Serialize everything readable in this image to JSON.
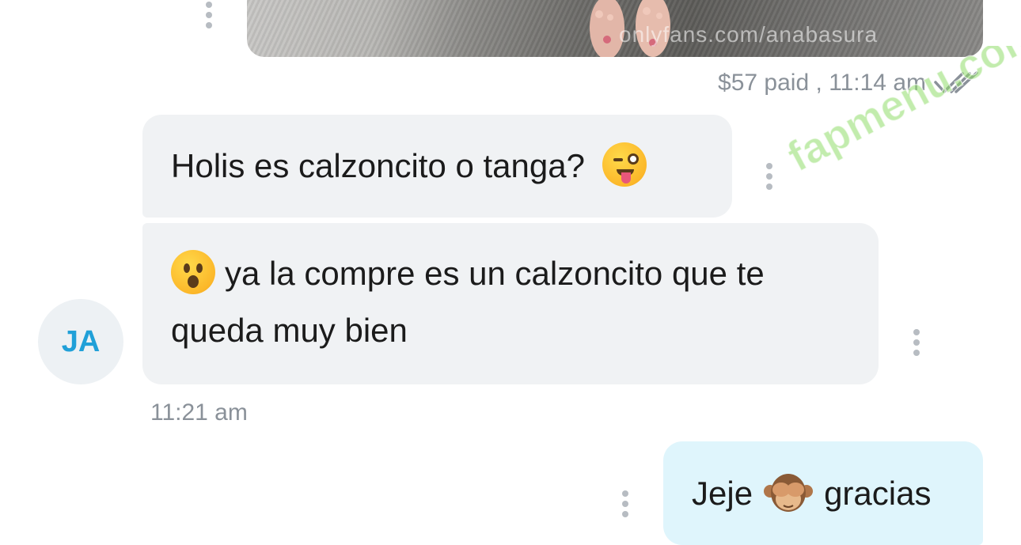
{
  "media": {
    "watermark_text": "onlyfans.com/anabasura",
    "paid_label": "$57 paid , 11:14 am"
  },
  "messages": [
    {
      "id": "m1",
      "direction": "incoming",
      "text": "Holis es calzoncito o tanga?",
      "emoji": "winking-face-with-tongue"
    },
    {
      "id": "m2",
      "direction": "incoming",
      "text_line1": "ya la compre es un calzoncito que te",
      "text_line2": "queda muy bien",
      "emoji": "face-with-open-mouth"
    },
    {
      "id": "m3",
      "direction": "outgoing",
      "text_before": "Jeje",
      "text_after": "gracias",
      "emoji": "see-no-evil-monkey"
    }
  ],
  "avatar": {
    "initials": "JA"
  },
  "incoming_time": "11:21 am",
  "overlay_watermark": "fapmenu.com",
  "colors": {
    "incoming_bubble": "#f0f2f4",
    "outgoing_bubble": "#dff5fc",
    "avatar_text": "#20a0d8",
    "meta_text": "#8a9199",
    "watermark_green": "#8fdc6a"
  }
}
